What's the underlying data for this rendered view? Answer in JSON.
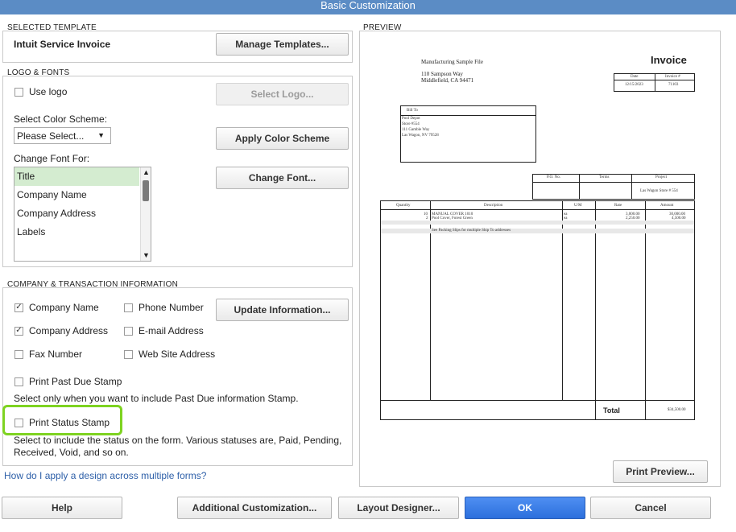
{
  "window": {
    "title": "Basic Customization"
  },
  "selected_template": {
    "heading": "SELECTED TEMPLATE",
    "name": "Intuit Service Invoice",
    "manage_button": "Manage Templates..."
  },
  "logo_fonts": {
    "heading": "LOGO & FONTS",
    "use_logo": "Use logo",
    "select_logo_button": "Select Logo...",
    "color_scheme_label": "Select Color Scheme:",
    "color_scheme_value": "Please Select...",
    "apply_color_button": "Apply Color Scheme",
    "change_font_for_label": "Change Font For:",
    "font_items": [
      "Title",
      "Company Name",
      "Company Address",
      "Labels"
    ],
    "change_font_button": "Change Font..."
  },
  "company_info": {
    "heading": "COMPANY & TRANSACTION INFORMATION",
    "company_name": "Company Name",
    "phone_number": "Phone Number",
    "update_button": "Update Information...",
    "company_address": "Company Address",
    "email_address": "E-mail Address",
    "fax_number": "Fax Number",
    "web_site": "Web Site Address",
    "past_due": "Print Past Due Stamp",
    "past_due_help": "Select only when you want to include Past Due information Stamp.",
    "status_stamp": "Print Status Stamp",
    "status_help_1": "Select to include the status on the form. Various statuses are, Paid, Pending,",
    "status_help_2": "Received, Void, and so on.",
    "checked": {
      "company_name": true,
      "company_address": true
    }
  },
  "help_link": "How do I apply a design across multiple forms?",
  "preview": {
    "heading": "PREVIEW",
    "company_name": "Manufacturing Sample File",
    "address_1": "110 Sampson Way",
    "address_2": "Middlefield, CA  94471",
    "invoice_title": "Invoice",
    "date_header": "Date",
    "invoice_no_header": "Invoice #",
    "date_value": "12/15/2023",
    "invoice_no_value": "71103",
    "bill_to_header": "Bill To",
    "bill_to_lines": [
      "Pool Depot",
      "Store #554",
      "111 Gamble Way",
      "Las Wagon, NV 79528"
    ],
    "po_header": "P.O. No.",
    "terms_header": "Terms",
    "project_header": "Project",
    "project_value": "Las Wagon Store # 554",
    "columns": [
      "Quantity",
      "Description",
      "U/M",
      "Rate",
      "Amount"
    ],
    "rows": [
      {
        "qty": "10",
        "desc": "MANUAL COVER 1010",
        "um": "ea",
        "rate": "3,000.00",
        "amount": "30,000.00"
      },
      {
        "qty": "2",
        "desc": "Pool Cover, Forest Green",
        "um": "ea",
        "rate": "2,250.00",
        "amount": "4,500.00"
      },
      {
        "qty": "",
        "desc": "",
        "um": "",
        "rate": "",
        "amount": ""
      },
      {
        "qty": "",
        "desc": "See Packing Slips for multiple Ship To addresses",
        "um": "",
        "rate": "",
        "amount": ""
      }
    ],
    "total_label": "Total",
    "total_value": "$34,500.00",
    "print_preview_button": "Print Preview..."
  },
  "footer": {
    "help": "Help",
    "additional": "Additional Customization...",
    "layout": "Layout Designer...",
    "ok": "OK",
    "cancel": "Cancel"
  }
}
